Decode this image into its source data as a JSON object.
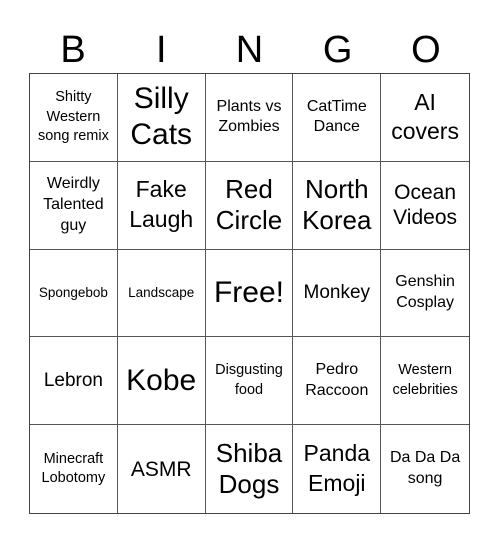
{
  "header": {
    "letters": [
      "B",
      "I",
      "N",
      "G",
      "O"
    ]
  },
  "cells": [
    {
      "text": "Shitty Western song remix",
      "size": "s14"
    },
    {
      "text": "Silly Cats",
      "size": "s30"
    },
    {
      "text": "Plants vs Zombies",
      "size": "s16"
    },
    {
      "text": "CatTime Dance",
      "size": "s16"
    },
    {
      "text": "AI covers",
      "size": "s23"
    },
    {
      "text": "Weirdly Talented guy",
      "size": "s16"
    },
    {
      "text": "Fake Laugh",
      "size": "s23"
    },
    {
      "text": "Red Circle",
      "size": "s26"
    },
    {
      "text": "North Korea",
      "size": "s26"
    },
    {
      "text": "Ocean Videos",
      "size": "s21"
    },
    {
      "text": "Spongebob",
      "size": "s13"
    },
    {
      "text": "Landscape",
      "size": "s13"
    },
    {
      "text": "Free!",
      "size": "s30"
    },
    {
      "text": "Monkey",
      "size": "s19"
    },
    {
      "text": "Genshin Cosplay",
      "size": "s16"
    },
    {
      "text": "Lebron",
      "size": "s19"
    },
    {
      "text": "Kobe",
      "size": "s30"
    },
    {
      "text": "Disgusting food",
      "size": "s14"
    },
    {
      "text": "Pedro Raccoon",
      "size": "s16"
    },
    {
      "text": "Western celebrities",
      "size": "s14"
    },
    {
      "text": "Minecraft Lobotomy",
      "size": "s14"
    },
    {
      "text": "ASMR",
      "size": "s21"
    },
    {
      "text": "Shiba Dogs",
      "size": "s26"
    },
    {
      "text": "Panda Emoji",
      "size": "s23"
    },
    {
      "text": "Da Da Da song",
      "size": "s16"
    }
  ]
}
